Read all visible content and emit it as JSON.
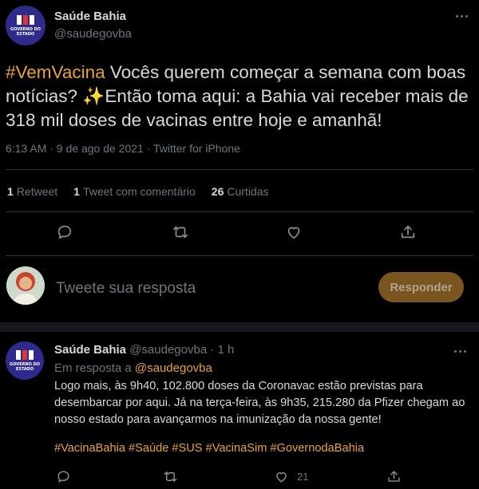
{
  "colors": {
    "background": "#000000",
    "accent": "#e8a33d",
    "muted": "#6e767d",
    "text": "#d9d9d9"
  },
  "main_tweet": {
    "name": "Saúde Bahia",
    "handle": "@saudegovba",
    "avatar_text": "GOVERNO DO ESTADO",
    "hashtag": "#VemVacina",
    "text_part1": " Vocês querem começar a semana com boas notícias? ",
    "emoji": "✨",
    "text_part2": "Então toma aqui: a Bahia vai receber mais de 318 mil doses de vacinas entre hoje e amanhã!",
    "meta": "6:13 AM · 9 de ago de 2021 · Twitter for iPhone",
    "stats": {
      "retweets_count": "1",
      "retweets_label": "Retweet",
      "quotes_count": "1",
      "quotes_label": "Tweet com comentário",
      "likes_count": "26",
      "likes_label": "Curtidas"
    },
    "actions": [
      "reply-icon",
      "retweet-icon",
      "like-icon",
      "share-icon"
    ]
  },
  "composer": {
    "placeholder": "Tweete sua resposta",
    "button_label": "Responder"
  },
  "reply_tweet": {
    "name": "Saúde Bahia",
    "handle": "@saudegovba",
    "time": " · 1 h",
    "reply_prefix": "Em resposta a ",
    "reply_to_handle": "@saudegovba",
    "avatar_text": "GOVERNO DO ESTADO",
    "body": "Logo mais, às 9h40, 102.800  doses da Coronavac estão previstas para desembarcar por aqui. Já na terça-feira, às 9h35, 215.280 da Pfizer chegam ao nosso estado para avançarmos na imunização da nossa gente!",
    "hashtags": "#VacinaBahia #Saúde #SUS #VacinaSim #GovernodaBahia",
    "like_count": "21"
  }
}
